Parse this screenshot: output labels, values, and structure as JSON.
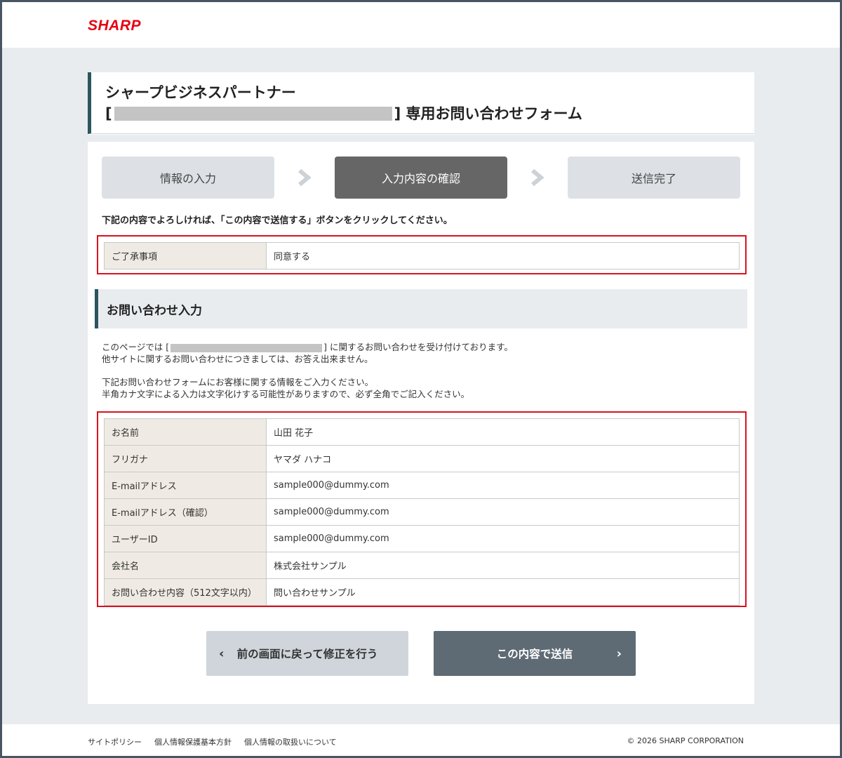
{
  "brand": {
    "logo_text": "SHARP",
    "accent_color": "#e60012"
  },
  "header": {
    "title_line1": "シャープビジネスパートナー",
    "title_prefix": "[",
    "title_suffix": "] 専用お問い合わせフォーム"
  },
  "steps": [
    {
      "label": "情報の入力",
      "active": false
    },
    {
      "label": "入力内容の確認",
      "active": true
    },
    {
      "label": "送信完了",
      "active": false
    }
  ],
  "instruction": "下記の内容でよろしければ、「この内容で送信する」ボタンをクリックしてください。",
  "consent": {
    "label": "ご了承事項",
    "value": "同意する"
  },
  "section_title": "お問い合わせ入力",
  "description": {
    "line1_prefix": "このページでは [",
    "line1_suffix": "] に関するお問い合わせを受け付けております。",
    "line2": "他サイトに関するお問い合わせにつきましては、お答え出来ません。",
    "line3": "下記お問い合わせフォームにお客様に関する情報をご入力ください。",
    "line4": "半角カナ文字による入力は文字化けする可能性がありますので、必ず全角でご記入ください。"
  },
  "form_rows": [
    {
      "label": "お名前",
      "value": "山田 花子"
    },
    {
      "label": "フリガナ",
      "value": "ヤマダ ハナコ"
    },
    {
      "label": "E-mailアドレス",
      "value": "sample000@dummy.com"
    },
    {
      "label": "E-mailアドレス（確認）",
      "value": "sample000@dummy.com"
    },
    {
      "label": "ユーザーID",
      "value": "sample000@dummy.com"
    },
    {
      "label": "会社名",
      "value": "株式会社サンプル"
    },
    {
      "label": "お問い合わせ内容（512文字以内）",
      "value": "問い合わせサンプル"
    }
  ],
  "buttons": {
    "back_label": "前の画面に戻って修正を行う",
    "send_label": "この内容で送信",
    "back_icon": "chevron-left-icon",
    "send_icon": "chevron-right-icon"
  },
  "footer": {
    "links": [
      "サイトポリシー",
      "個人情報保護基本方針",
      "個人情報の取扱いについて"
    ],
    "copyright": "© 2026 SHARP CORPORATION"
  }
}
